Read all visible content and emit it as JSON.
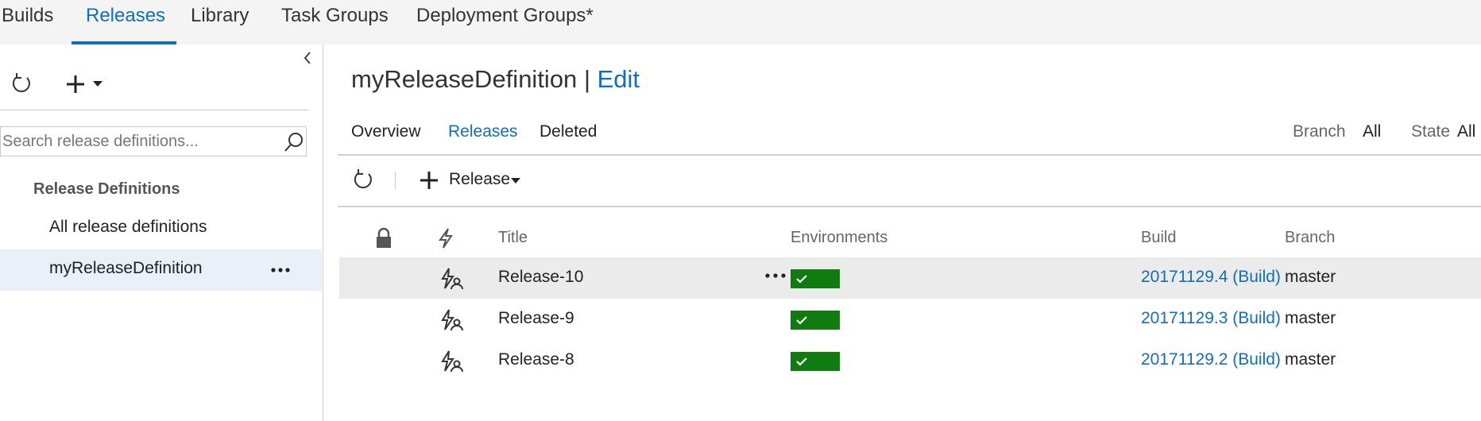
{
  "top_nav": {
    "tabs": [
      {
        "label": "Builds"
      },
      {
        "label": "Releases"
      },
      {
        "label": "Library"
      },
      {
        "label": "Task Groups"
      },
      {
        "label": "Deployment Groups*"
      }
    ],
    "active_tab": "Releases"
  },
  "left_panel": {
    "search_placeholder": "Search release definitions...",
    "section_heading": "Release Definitions",
    "items": [
      {
        "label": "All release definitions"
      },
      {
        "label": "myReleaseDefinition"
      }
    ],
    "selected_item": "myReleaseDefinition"
  },
  "main": {
    "definition_name": "myReleaseDefinition",
    "separator": "|",
    "edit_label": "Edit",
    "tabs": [
      {
        "label": "Overview"
      },
      {
        "label": "Releases"
      },
      {
        "label": "Deleted"
      }
    ],
    "active_tab": "Releases",
    "filters": {
      "branch_label": "Branch",
      "branch_value": "All",
      "state_label": "State",
      "state_value": "All"
    },
    "toolbar": {
      "release_label": "Release"
    },
    "table": {
      "columns": [
        "Title",
        "Environments",
        "Build",
        "Branch"
      ],
      "rows": [
        {
          "title": "Release-10",
          "environment_status": "succeeded",
          "build": "20171129.4 (Build)",
          "branch": "master"
        },
        {
          "title": "Release-9",
          "environment_status": "succeeded",
          "build": "20171129.3 (Build)",
          "branch": "master"
        },
        {
          "title": "Release-8",
          "environment_status": "succeeded",
          "build": "20171129.2 (Build)",
          "branch": "master"
        }
      ]
    }
  },
  "icons": {
    "refresh": "refresh-icon",
    "add": "plus-icon",
    "collapse": "chevron-left-icon",
    "search": "search-icon",
    "lock": "lock-icon",
    "trigger": "lightning-icon",
    "manual_trigger": "lightning-user-icon",
    "more": "ellipsis-icon",
    "check": "check-icon"
  },
  "colors": {
    "accent": "#106ebe",
    "success": "#107c10",
    "selected_bg": "#eaf0f8",
    "hover_bg": "#ebebeb"
  }
}
